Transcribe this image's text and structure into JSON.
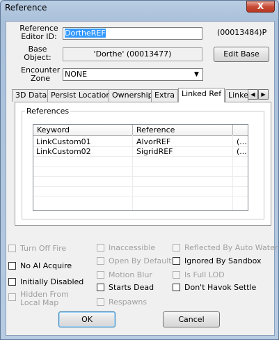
{
  "window": {
    "title": "Reference",
    "close_glyph": "X"
  },
  "fields": {
    "editor_id_label": "Reference\nEditor ID:",
    "editor_id_value": "DortheREF",
    "form_id": "(00013484)P",
    "base_label": "Base\nObject:",
    "base_value": "'Dorthe' (00013477)",
    "edit_base_label": "Edit Base",
    "encounter_label": "Encounter\nZone",
    "encounter_value": "NONE"
  },
  "tabs": [
    "3D Data",
    "Persist Location",
    "Ownership",
    "Extra",
    "Linked Ref",
    "Linke"
  ],
  "active_tab": "Linked Ref",
  "references": {
    "group_label": "References",
    "columns": [
      "Keyword",
      "Reference"
    ],
    "rows": [
      {
        "keyword": "LinkCustom01",
        "reference": "AlvorREF",
        "extra": "(..."
      },
      {
        "keyword": "LinkCustom02",
        "reference": "SigridREF",
        "extra": "(..."
      }
    ]
  },
  "checkboxes": {
    "col1": [
      {
        "label": "Turn Off Fire",
        "disabled": true
      },
      {
        "label": "No AI Acquire",
        "disabled": false
      },
      {
        "label": "Initially Disabled",
        "disabled": false
      },
      {
        "label": "Hidden From\nLocal Map",
        "disabled": true
      }
    ],
    "col2": [
      {
        "label": "Inaccessible",
        "disabled": true
      },
      {
        "label": "Open By Default",
        "disabled": true
      },
      {
        "label": "Motion Blur",
        "disabled": true
      },
      {
        "label": "Starts Dead",
        "disabled": false
      },
      {
        "label": "Respawns",
        "disabled": true
      }
    ],
    "col3": [
      {
        "label": "Reflected By Auto Water",
        "disabled": true
      },
      {
        "label": "Ignored By Sandbox",
        "disabled": false
      },
      {
        "label": "Is Full LOD",
        "disabled": true
      },
      {
        "label": "Don't Havok Settle",
        "disabled": false
      }
    ]
  },
  "buttons": {
    "ok": "OK",
    "cancel": "Cancel"
  },
  "colors": {
    "selection": "#3399ff",
    "accent_close": "#c74d38"
  }
}
